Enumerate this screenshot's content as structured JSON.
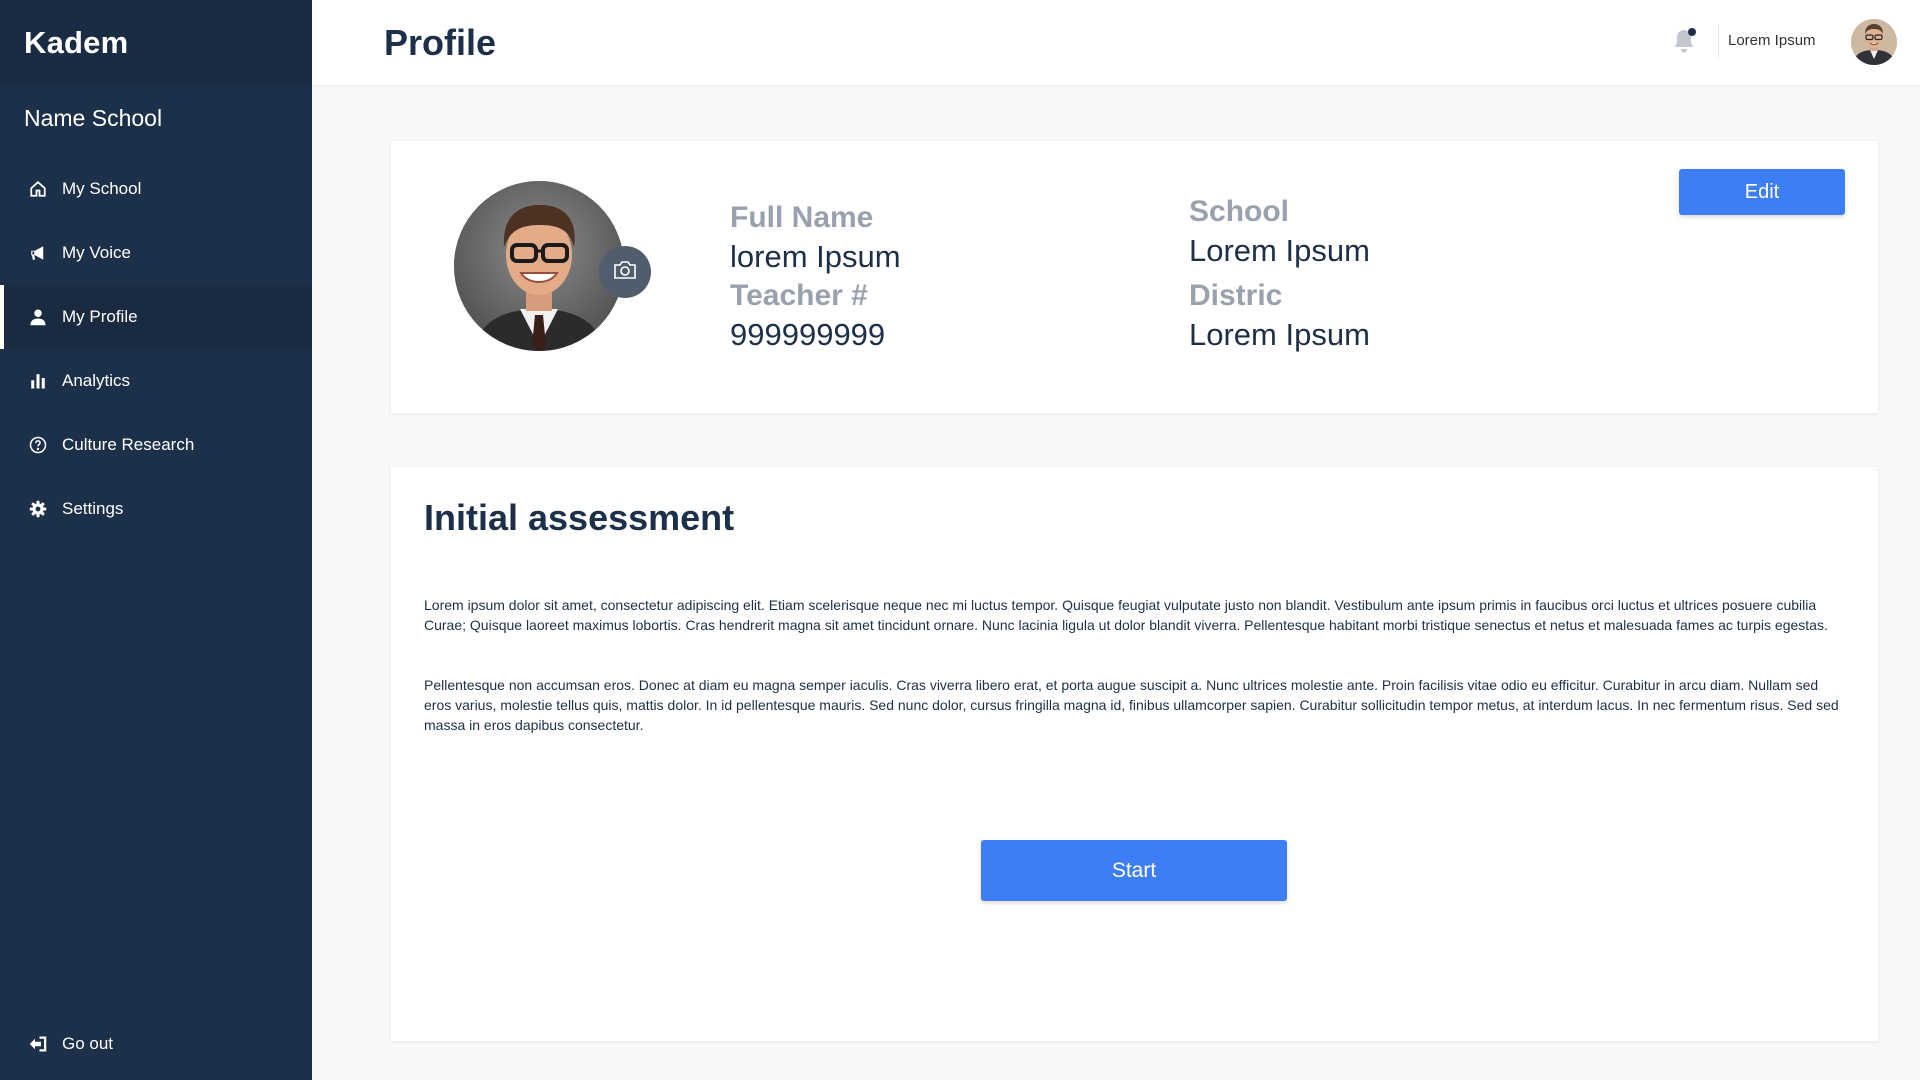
{
  "sidebar": {
    "brand": "Kadem",
    "school_name": "Name School",
    "items": [
      {
        "label": "My School",
        "icon": "home-icon"
      },
      {
        "label": "My Voice",
        "icon": "megaphone-icon"
      },
      {
        "label": "My Profile",
        "icon": "person-icon",
        "active": true
      },
      {
        "label": "Analytics",
        "icon": "bar-chart-icon"
      },
      {
        "label": "Culture Research",
        "icon": "question-circle-icon"
      },
      {
        "label": "Settings",
        "icon": "gear-icon"
      }
    ],
    "logout_label": "Go out"
  },
  "header": {
    "title": "Profile",
    "user_name": "Lorem Ipsum"
  },
  "profile": {
    "full_name_label": "Full Name",
    "full_name_value": "lorem Ipsum",
    "teacher_label": "Teacher #",
    "teacher_value": "999999999",
    "school_label": "School",
    "school_value": "Lorem Ipsum",
    "district_label": "Distric",
    "district_value": "Lorem Ipsum",
    "edit_label": "Edit"
  },
  "assessment": {
    "title": "Initial assessment",
    "paragraph1": "Lorem ipsum dolor sit amet, consectetur adipiscing elit. Etiam scelerisque neque nec mi luctus tempor. Quisque feugiat vulputate justo non blandit. Vestibulum ante ipsum primis in faucibus orci luctus et ultrices posuere cubilia Curae; Quisque laoreet maximus lobortis. Cras hendrerit magna sit amet tincidunt ornare. Nunc lacinia ligula ut dolor blandit viverra. Pellentesque habitant morbi tristique senectus et netus et malesuada fames ac turpis egestas.",
    "paragraph2": "Pellentesque non accumsan eros. Donec at diam eu magna semper iaculis. Cras viverra libero erat, et porta augue suscipit a. Nunc ultrices molestie ante. Proin facilisis vitae odio eu efficitur. Curabitur in arcu diam. Nullam sed eros varius, molestie tellus quis, mattis dolor. In id pellentesque mauris. Sed nunc dolor, cursus fringilla magna id, finibus ullamcorper sapien. Curabitur sollicitudin tempor metus, at interdum lacus. In nec fermentum risus. Sed sed massa in eros dapibus consectetur.",
    "start_label": "Start"
  },
  "colors": {
    "sidebar_bg": "#1d3049",
    "accent": "#3d7ef5",
    "muted_label": "#98a1ad"
  }
}
